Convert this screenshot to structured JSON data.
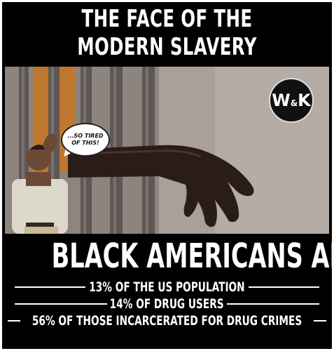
{
  "title": {
    "line1": "THE FACE OF THE",
    "line2": "MODERN SLAVERY"
  },
  "badge": {
    "w": "W",
    "amp": "&",
    "k": "K"
  },
  "speech_bubble": {
    "line1": "...SO TIRED",
    "line2": "OF THIS!"
  },
  "headline": "BLACK AMERICANS ARE",
  "stats": [
    "13% OF THE US POPULATION",
    "14% OF DRUG USERS",
    "56% OF THOSE INCARCERATED FOR DRUG CRIMES"
  ],
  "colors": {
    "background": "#000000",
    "text": "#ffffff"
  }
}
